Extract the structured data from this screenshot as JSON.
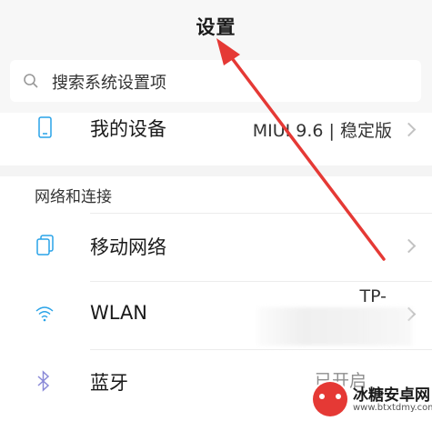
{
  "header": {
    "title": "设置"
  },
  "search": {
    "placeholder": "搜索系统设置项"
  },
  "device": {
    "label": "我的设备",
    "value": "MIUI 9.6 | 稳定版"
  },
  "network": {
    "section_title": "网络和连接",
    "items": [
      {
        "label": "移动网络",
        "value": "",
        "icon": "sim-card-icon"
      },
      {
        "label": "WLAN",
        "value": "TP-",
        "icon": "wifi-icon"
      },
      {
        "label": "蓝牙",
        "value": "已开启",
        "icon": "bluetooth-icon"
      }
    ]
  },
  "watermark": {
    "name": "冰糖安卓网",
    "url": "www.btxtdmy.com"
  },
  "colors": {
    "arrow": "#e53935",
    "background": "#f7f7f7",
    "icon_accent": "#29a3e8"
  }
}
